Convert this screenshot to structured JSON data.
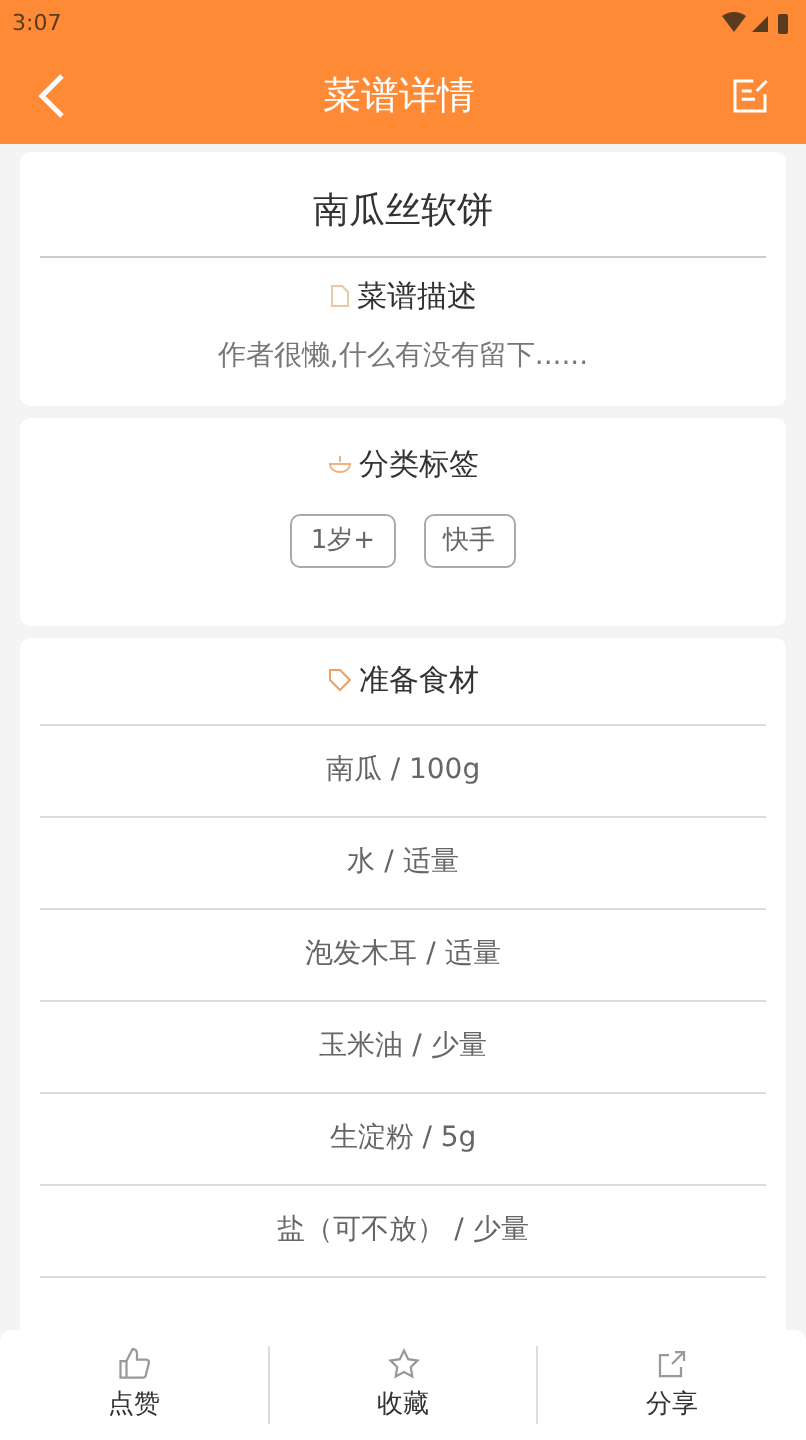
{
  "status_bar": {
    "time": "3:07"
  },
  "header": {
    "title": "菜谱详情"
  },
  "recipe": {
    "name": "南瓜丝软饼",
    "description_heading": "菜谱描述",
    "description": "作者很懒,什么有没有留下......"
  },
  "tags_section": {
    "heading": "分类标签",
    "tags": [
      "1岁+",
      "快手"
    ]
  },
  "ingredients_section": {
    "heading": "准备食材",
    "items": [
      "南瓜 / 100g",
      "水 / 适量",
      "泡发木耳 / 适量",
      "玉米油 / 少量",
      "生淀粉 / 5g",
      "盐（可不放） / 少量"
    ]
  },
  "bottom_bar": [
    {
      "kind": "like",
      "label": "点赞"
    },
    {
      "kind": "star",
      "label": "收藏"
    },
    {
      "kind": "share",
      "label": "分享"
    }
  ]
}
